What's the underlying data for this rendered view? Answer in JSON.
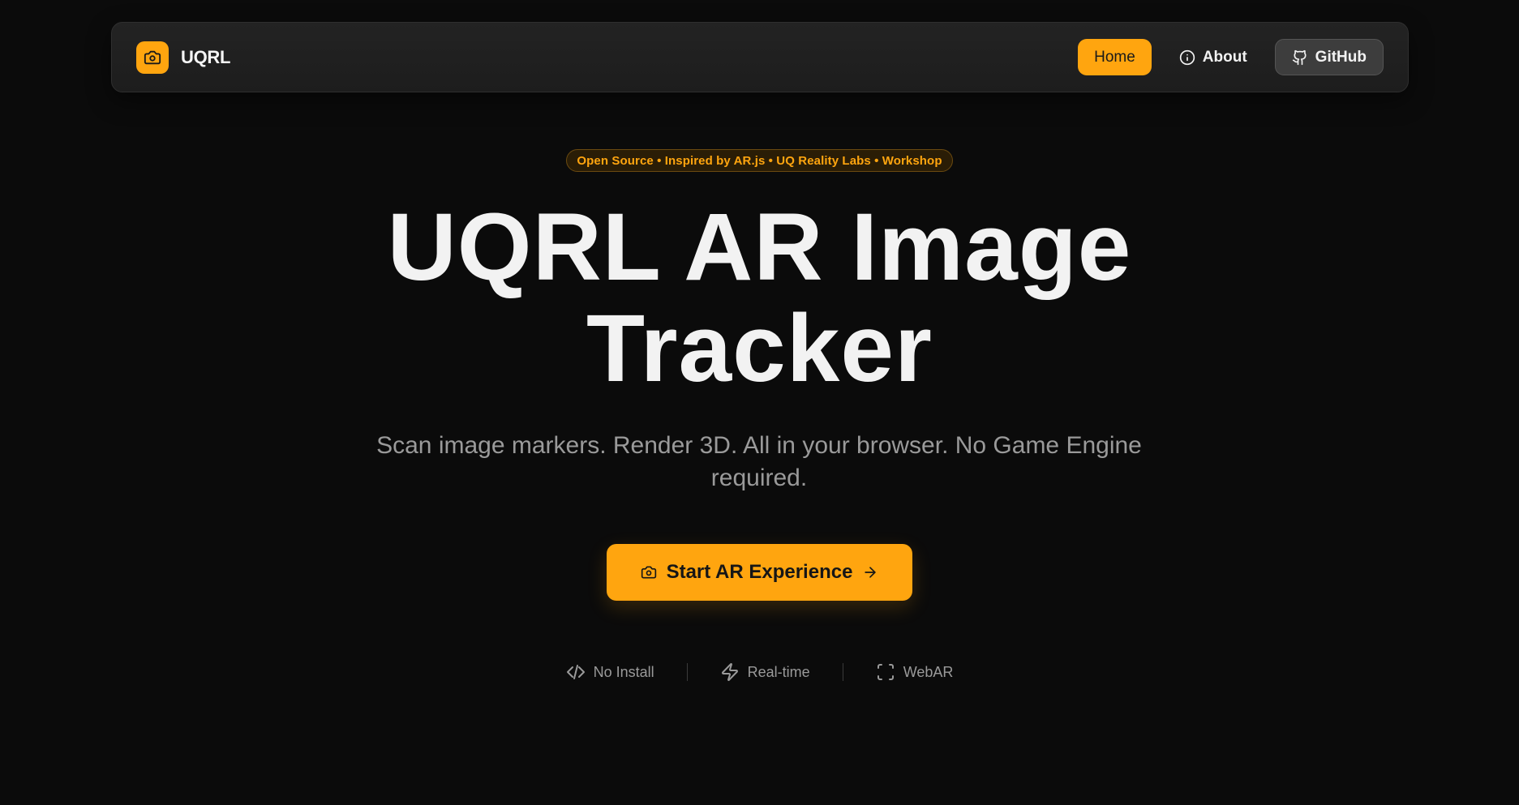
{
  "brand": {
    "name": "UQRL",
    "icon": "camera-icon",
    "accent": "#ffa50f"
  },
  "nav": {
    "home_label": "Home",
    "about_label": "About",
    "about_icon": "info-icon",
    "github_label": "GitHub",
    "github_icon": "github-icon"
  },
  "hero": {
    "tagline": "Open Source • Inspired by AR.js • UQ Reality Labs • Workshop",
    "title_line1": "UQRL AR Image",
    "title_line2": "Tracker",
    "subtitle": "Scan image markers. Render 3D. All in your browser. No Game Engine required.",
    "cta_label": "Start AR Experience",
    "cta_icon": "camera-icon",
    "cta_arrow_icon": "arrow-right-icon"
  },
  "features": [
    {
      "label": "No Install",
      "icon": "code-icon"
    },
    {
      "label": "Real-time",
      "icon": "lightning-icon"
    },
    {
      "label": "WebAR",
      "icon": "scan-frame-icon"
    }
  ],
  "colors": {
    "background": "#0b0b0b",
    "accent": "#ffa50f",
    "muted_text": "#9a9a9a"
  }
}
